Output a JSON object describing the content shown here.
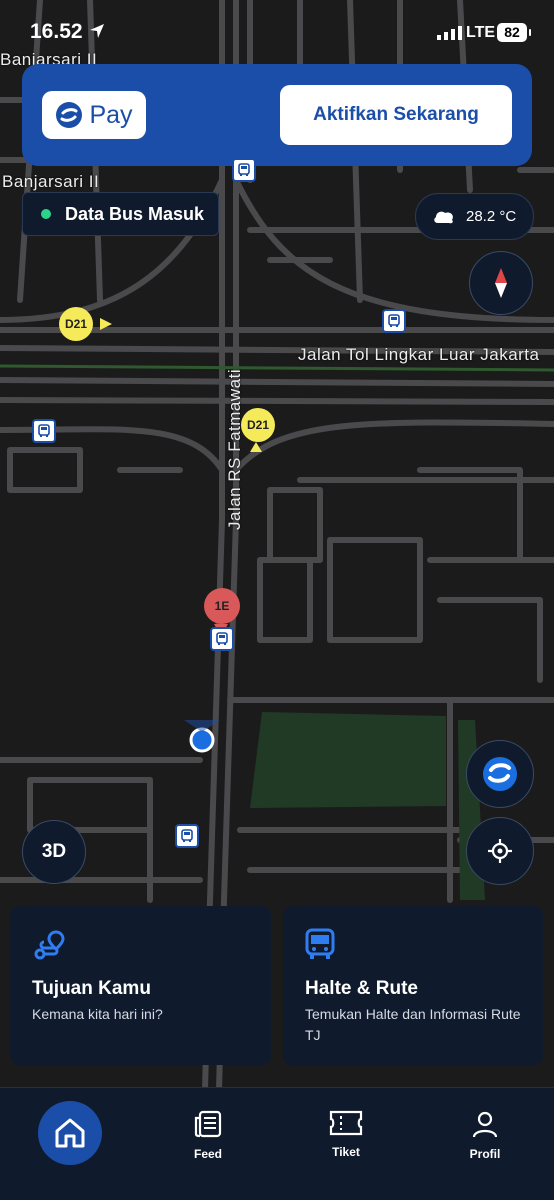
{
  "status_bar": {
    "time": "16.52",
    "network": "LTE",
    "battery": "82"
  },
  "banner": {
    "pay_label": "Pay",
    "activate_label": "Aktifkan Sekarang"
  },
  "map": {
    "labels": {
      "banjarsari_top": "Banjarsari II",
      "banjarsari": "Banjarsari II",
      "toll_road": "Jalan Tol Lingkar Luar Jakarta",
      "fatmawati": "Jalan RS Fatmawati"
    },
    "route_badges": [
      "D21",
      "D21",
      "1E"
    ],
    "data_bus_label": "Data Bus Masuk",
    "temperature": "28.2 °C",
    "btn_3d": "3D"
  },
  "cards": {
    "destination": {
      "title": "Tujuan Kamu",
      "subtitle": "Kemana kita hari ini?"
    },
    "stops": {
      "title": "Halte & Rute",
      "subtitle": "Temukan Halte dan Informasi Rute TJ"
    }
  },
  "nav": {
    "feed": "Feed",
    "ticket": "Tiket",
    "profile": "Profil"
  },
  "colors": {
    "brand_blue": "#1b4ea8",
    "dark_panel": "#0f1a2d",
    "live_green": "#2ed38a",
    "badge_yellow": "#f5ea5a",
    "badge_red": "#d9595b"
  }
}
